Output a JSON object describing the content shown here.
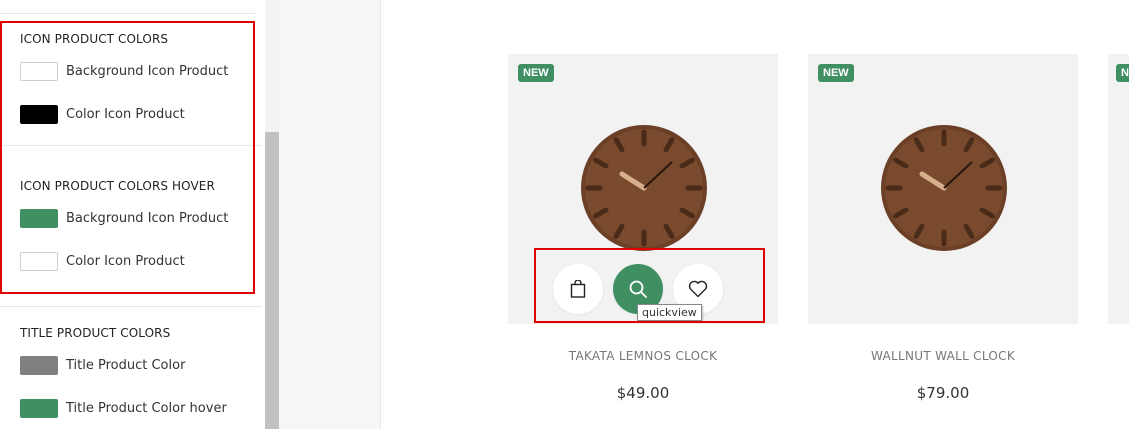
{
  "panel": {
    "sections": [
      {
        "title": "ICON PRODUCT COLORS",
        "rows": [
          {
            "label": "Background Icon Product",
            "color": "#ffffff"
          },
          {
            "label": "Color Icon Product",
            "color": "#000000"
          }
        ]
      },
      {
        "title": "ICON PRODUCT COLORS HOVER",
        "rows": [
          {
            "label": "Background Icon Product",
            "color": "#3f8f63"
          },
          {
            "label": "Color Icon Product",
            "color": "#ffffff"
          }
        ]
      },
      {
        "title": "TITLE PRODUCT COLORS",
        "rows": [
          {
            "label": "Title Product Color",
            "color": "#808080"
          },
          {
            "label": "Title Product Color hover",
            "color": "#3f8f63"
          }
        ]
      }
    ]
  },
  "products": [
    {
      "badge": "NEW",
      "name": "TAKATA LEMNOS CLOCK",
      "price": "$49.00"
    },
    {
      "badge": "NEW",
      "name": "WALLNUT WALL CLOCK",
      "price": "$79.00"
    },
    {
      "badge": "NEW"
    }
  ],
  "actions": {
    "icons": [
      "shopping-bag-icon",
      "search-icon",
      "heart-icon"
    ],
    "tooltip": "quickview"
  },
  "colors": {
    "accent": "#3f8f63",
    "highlight_border": "#e00000"
  }
}
